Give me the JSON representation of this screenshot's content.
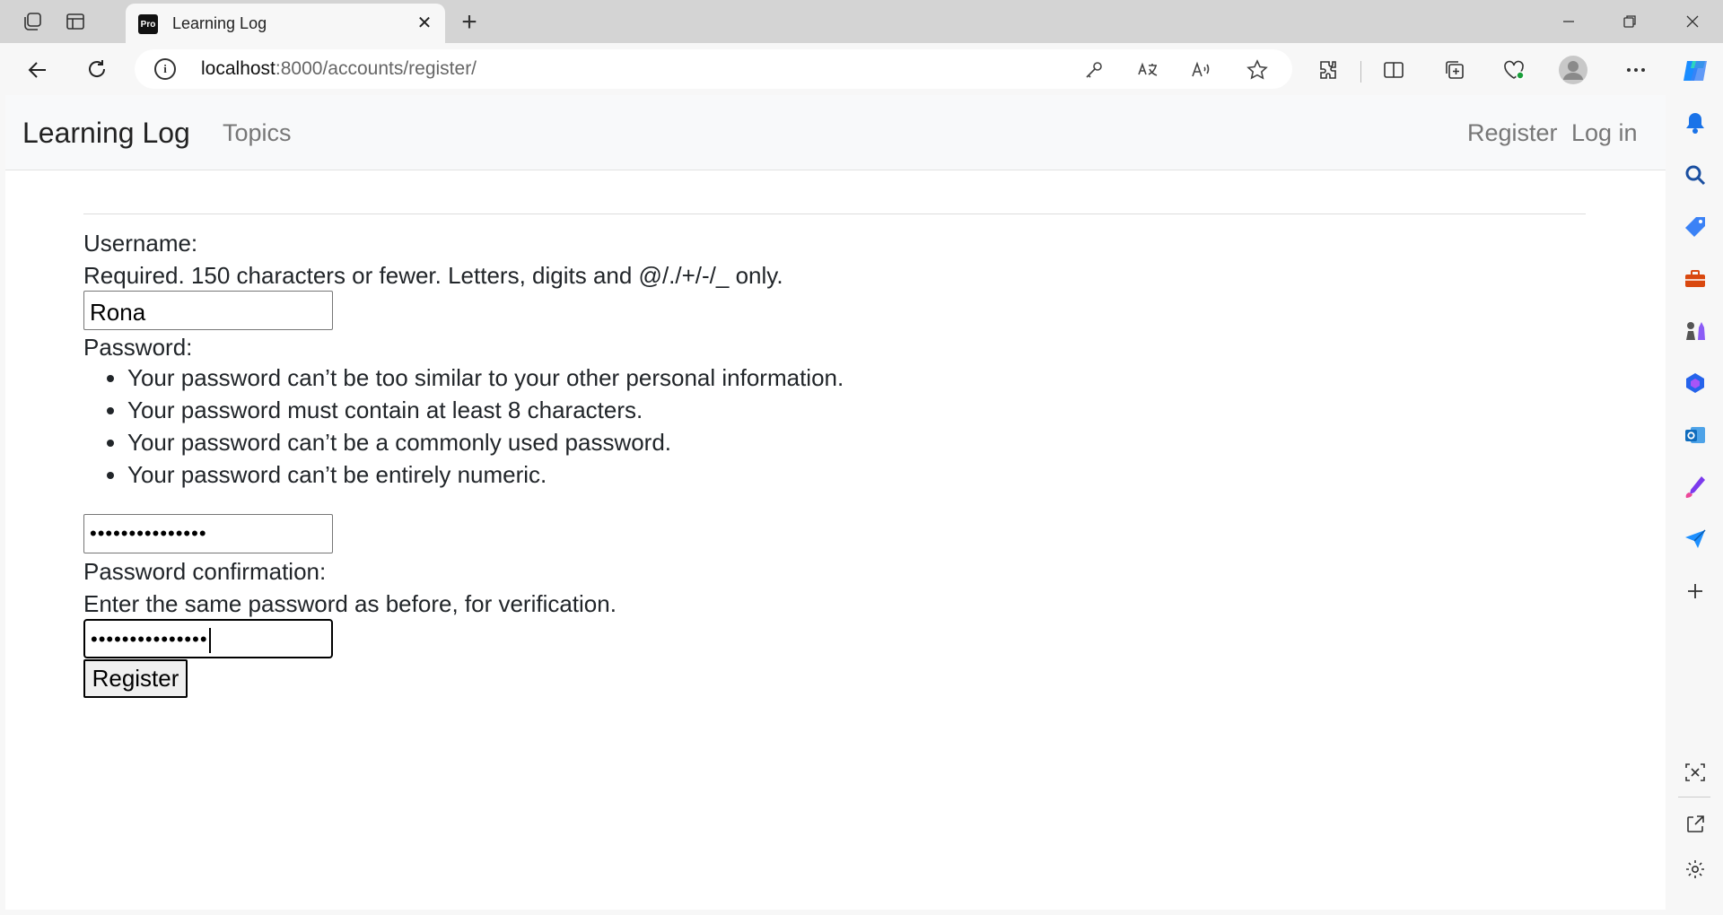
{
  "browser": {
    "tab_title": "Learning Log",
    "tab_favicon": "Pro",
    "url_host": "localhost",
    "url_path": ":8000/accounts/register/"
  },
  "site": {
    "brand": "Learning Log",
    "nav_topics": "Topics",
    "nav_register": "Register",
    "nav_login": "Log in"
  },
  "form": {
    "username_label": "Username:",
    "username_help": "Required. 150 characters or fewer. Letters, digits and @/./+/-/_ only.",
    "username_value": "Rona",
    "password_label": "Password:",
    "password_rules": [
      "Your password can’t be too similar to your other personal information.",
      "Your password must contain at least 8 characters.",
      "Your password can’t be a commonly used password.",
      "Your password can’t be entirely numeric."
    ],
    "password_value": "•••••••••••••••",
    "confirm_label": "Password confirmation:",
    "confirm_help": "Enter the same password as before, for verification.",
    "confirm_value": "•••••••••••••••",
    "submit_label": "Register"
  },
  "colors": {
    "copilot": "#1a8cff",
    "bell": "#1a73e8",
    "tag": "#3b82f6",
    "toolbox": "#d9480f",
    "games": "#8b5cf6",
    "m365": "#2563eb",
    "outlook": "#0f6cbd",
    "designer": "#7c3aed",
    "send": "#1e90ff"
  }
}
